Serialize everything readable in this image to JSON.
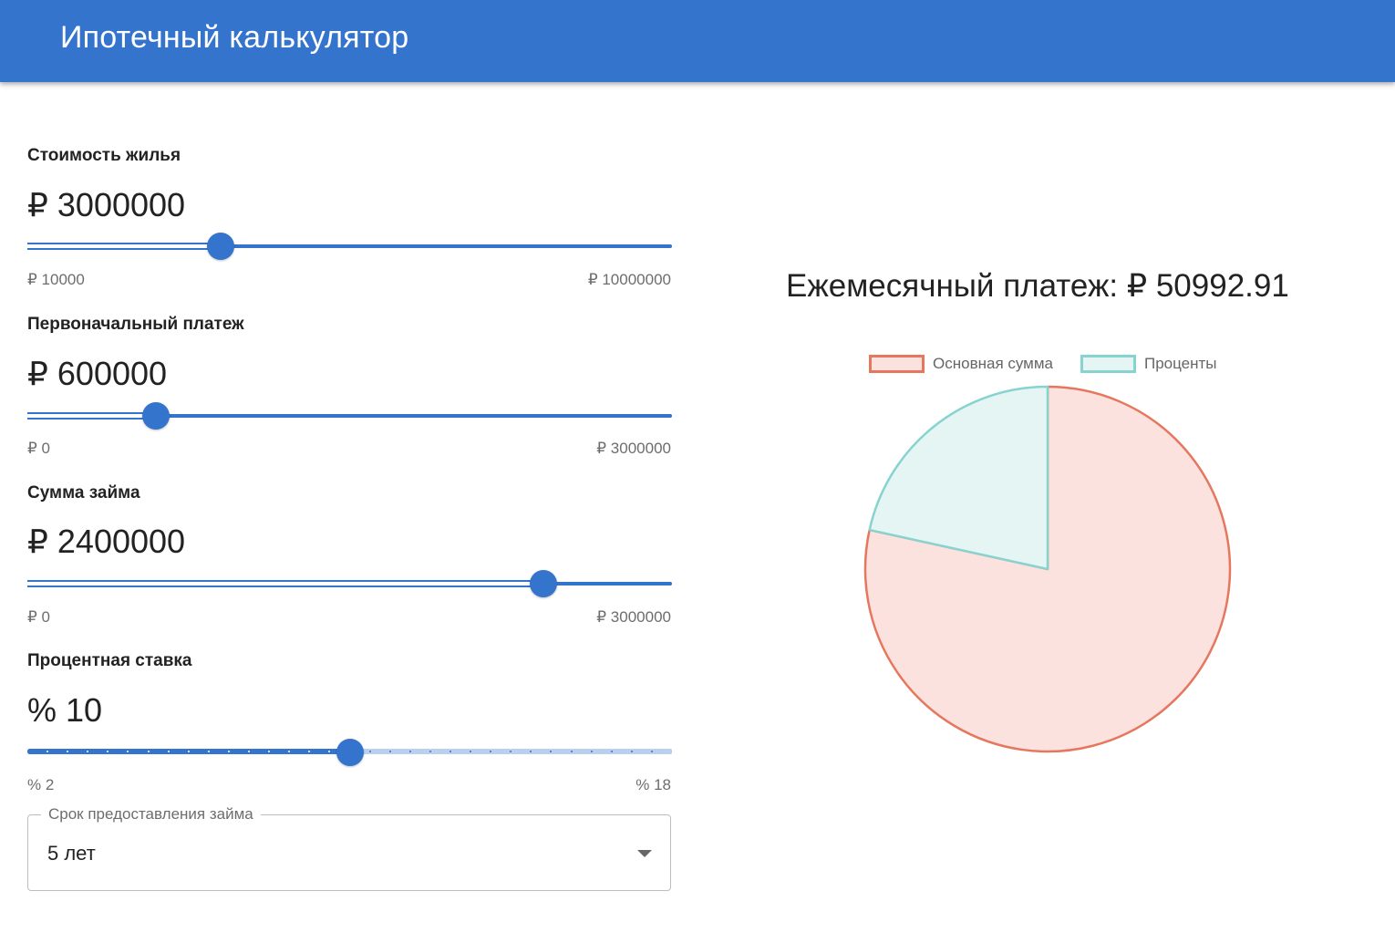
{
  "app": {
    "title": "Ипотечный калькулятор"
  },
  "home_price": {
    "label": "Стоимость жилья",
    "value_text": "₽ 3000000",
    "min_text": "₽ 10000",
    "max_text": "₽ 10000000",
    "value": 3000000,
    "min": 10000,
    "max": 10000000
  },
  "down_payment": {
    "label": "Первоначальный платеж",
    "value_text": "₽ 600000",
    "min_text": "₽ 0",
    "max_text": "₽ 3000000",
    "value": 600000,
    "min": 0,
    "max": 3000000
  },
  "loan_amount": {
    "label": "Сумма займа",
    "value_text": "₽ 2400000",
    "min_text": "₽ 0",
    "max_text": "₽ 3000000",
    "value": 2400000,
    "min": 0,
    "max": 3000000
  },
  "interest_rate": {
    "label": "Процентная ставка",
    "value_text": "% 10",
    "min_text": "% 2",
    "max_text": "% 18",
    "value": 10,
    "min": 2,
    "max": 18,
    "step": 0.5
  },
  "loan_term": {
    "label": "Срок предоставления займа",
    "selected": "5 лет"
  },
  "result": {
    "monthly_payment_text": "Ежемесячный платеж: ₽ 50992.91"
  },
  "colors": {
    "primary": "#3474cd",
    "principal_border": "#e5775e",
    "principal_fill": "#fbe2de",
    "interest_border": "#86d3d0",
    "interest_fill": "#e5f5f4"
  },
  "chart_data": {
    "type": "pie",
    "legend_position": "top",
    "series": [
      {
        "name": "Основная сумма",
        "value": 2400000
      },
      {
        "name": "Проценты",
        "value": 659574.6
      }
    ]
  }
}
